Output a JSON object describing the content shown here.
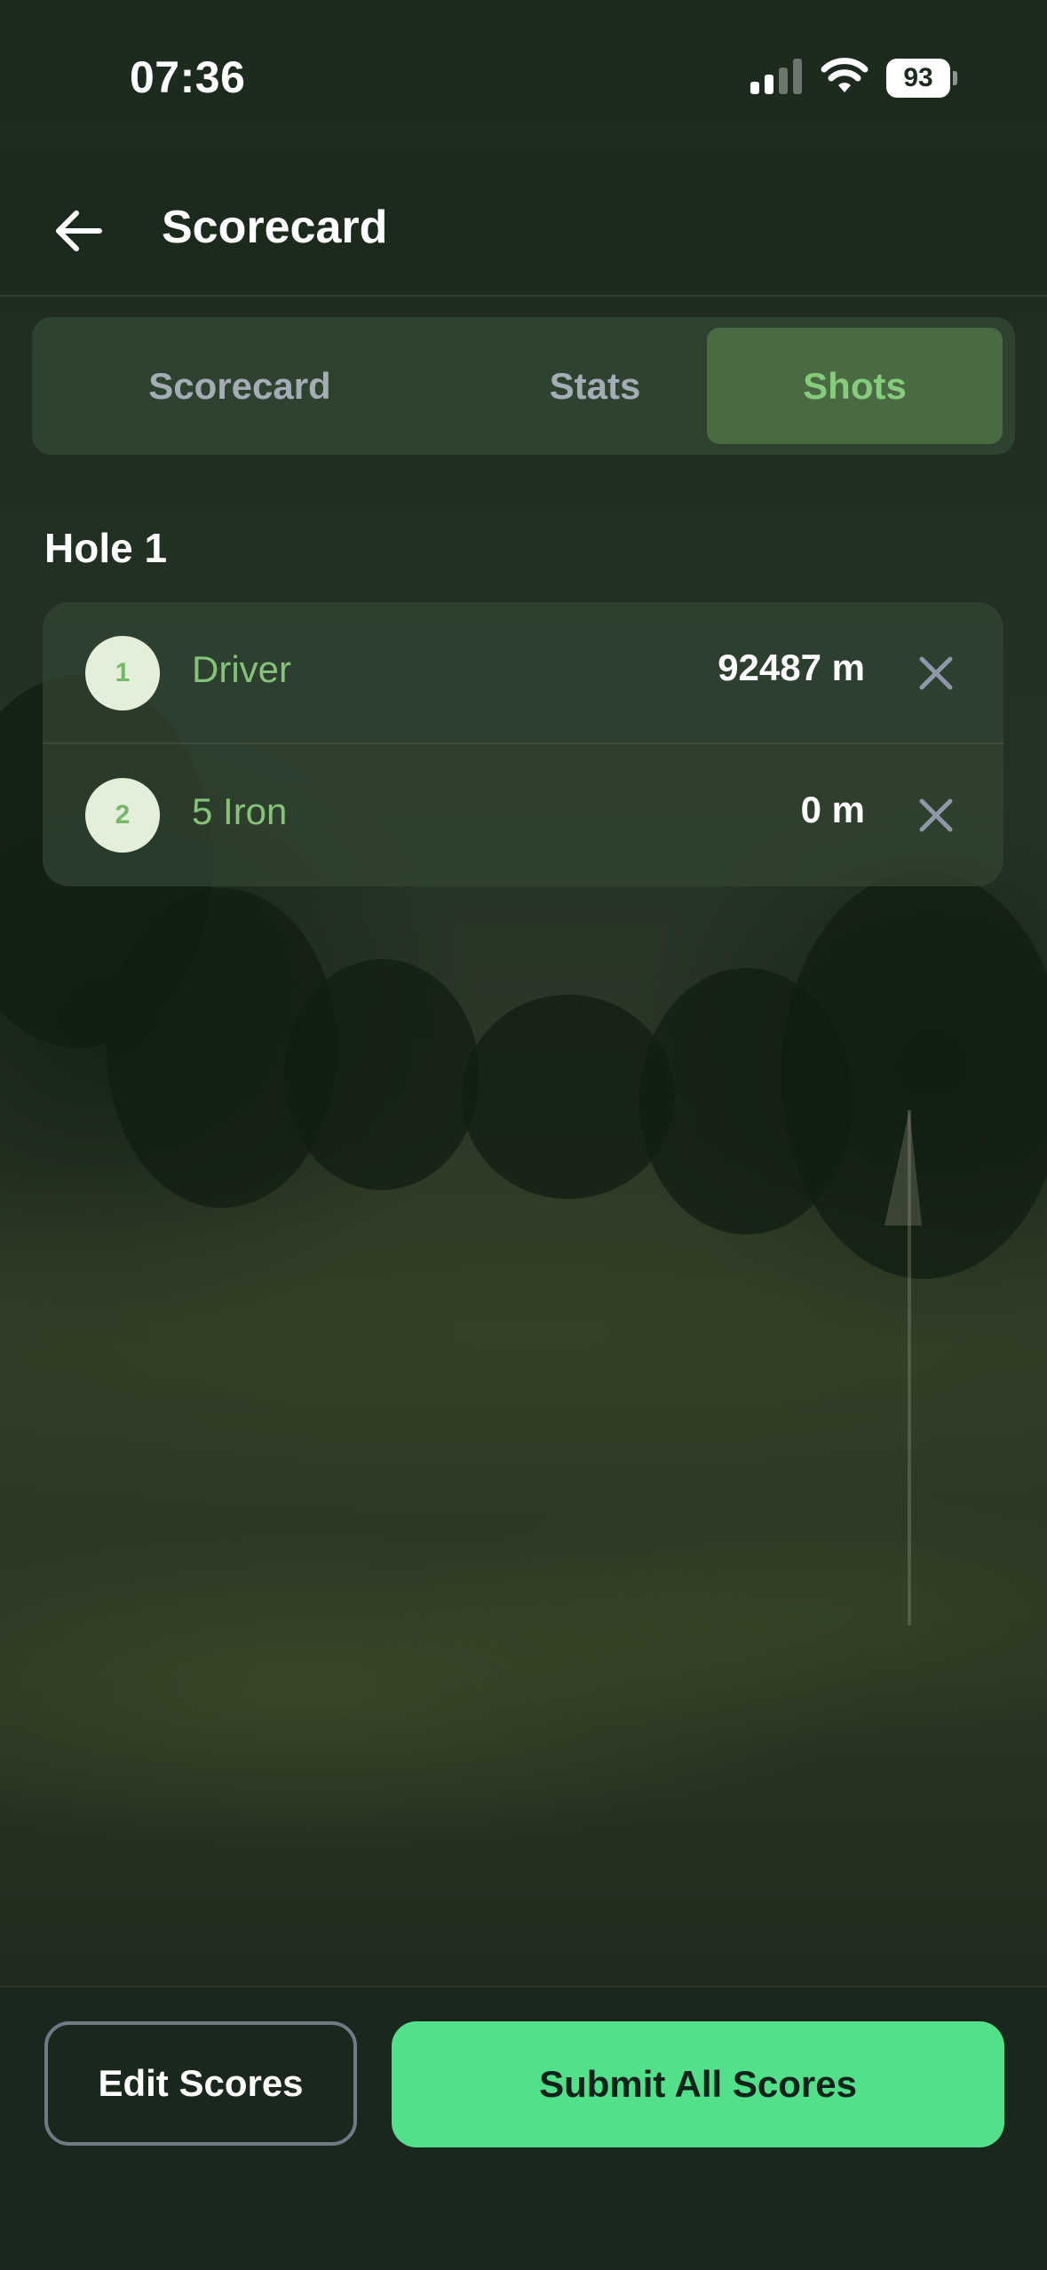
{
  "status_bar": {
    "time": "07:36",
    "battery_level": "93",
    "icons": [
      "cellular-signal-icon",
      "wifi-icon",
      "battery-icon"
    ]
  },
  "header": {
    "title": "Scorecard",
    "back_icon": "arrow-left-icon"
  },
  "tabs": [
    {
      "label": "Scorecard",
      "active": false
    },
    {
      "label": "Stats",
      "active": false
    },
    {
      "label": "Shots",
      "active": true
    }
  ],
  "hole": {
    "title": "Hole 1",
    "shots": [
      {
        "number": "1",
        "club": "Driver",
        "distance": "92487 m",
        "remove_icon": "close-icon"
      },
      {
        "number": "2",
        "club": "5 Iron",
        "distance": "0 m",
        "remove_icon": "close-icon"
      }
    ]
  },
  "actions": {
    "edit_label": "Edit Scores",
    "submit_label": "Submit All Scores"
  },
  "colors": {
    "accent_green": "#52e08a",
    "active_tab_bg": "#496a42",
    "active_tab_text": "#86cc7c",
    "club_text": "#86c27a",
    "background": "#1c2a1e"
  }
}
